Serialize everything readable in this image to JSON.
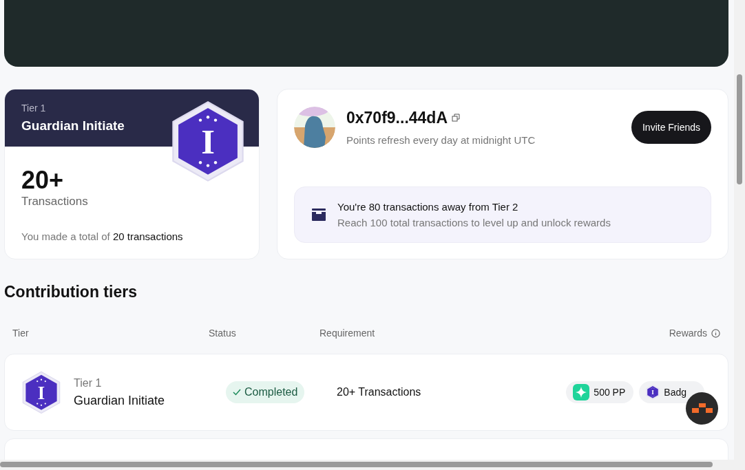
{
  "tier_card": {
    "tier_label": "Tier 1",
    "tier_name": "Guardian Initiate",
    "badge_letter": "I",
    "count": "20+",
    "count_label": "Transactions",
    "summary": "You made a total of **20 transactions**"
  },
  "profile": {
    "address": "0x70f9...44dA",
    "subtitle": "Points refresh every day at midnight UTC",
    "invite_button": "Invite Friends",
    "progress_title": "You're 80 transactions away from Tier 2",
    "progress_subtitle": "Reach 100 total transactions to level up and unlock rewards"
  },
  "section_title": "Contribution tiers",
  "table": {
    "columns": [
      "Tier",
      "Status",
      "Requirement",
      "Rewards"
    ],
    "rows": [
      {
        "tier_label": "Tier 1",
        "tier_name": "Guardian Initiate",
        "badge_letter": "I",
        "status": "Completed",
        "completed": true,
        "requirement": "20+ Transactions",
        "rewards": [
          {
            "kind": "points",
            "label": "500 PP"
          },
          {
            "kind": "badge",
            "label": "Badg",
            "badge_letter": "I"
          }
        ]
      }
    ]
  }
}
